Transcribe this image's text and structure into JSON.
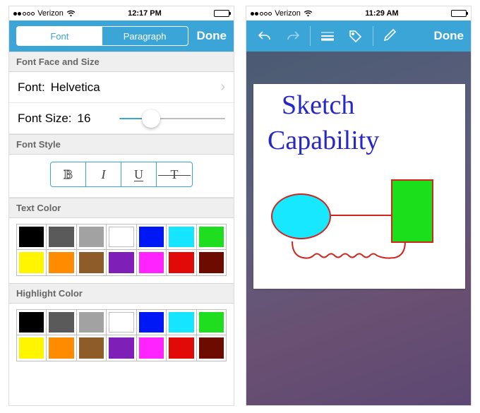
{
  "left": {
    "status": {
      "carrier": "Verizon",
      "time": "12:17 PM"
    },
    "toolbar": {
      "seg_font": "Font",
      "seg_paragraph": "Paragraph",
      "done": "Done"
    },
    "font_face_size_header": "Font Face and Size",
    "font_label": "Font:",
    "font_value": "Helvetica",
    "font_size_label": "Font Size:",
    "font_size_value": "16",
    "font_style_header": "Font Style",
    "style_bold": "B",
    "style_italic": "I",
    "style_underline": "U",
    "style_strike": "T",
    "text_color_header": "Text Color",
    "text_colors_row1": [
      "#000000",
      "#5a5a5a",
      "#a2a2a2",
      "#ffffff",
      "#0018f5",
      "#16e5ff",
      "#1fde1f"
    ],
    "text_colors_row2": [
      "#fff500",
      "#ff8b00",
      "#8e5c29",
      "#7e1fb8",
      "#ff24ff",
      "#e20909",
      "#6d0b00"
    ],
    "highlight_color_header": "Highlight Color",
    "highlight_colors_row1": [
      "#000000",
      "#5a5a5a",
      "#a2a2a2",
      "#ffffff",
      "#0018f5",
      "#16e5ff",
      "#1fde1f"
    ],
    "highlight_colors_row2": [
      "#fff500",
      "#ff8b00",
      "#8e5c29",
      "#7e1fb8",
      "#ff24ff",
      "#e20909",
      "#6d0b00"
    ]
  },
  "right": {
    "status": {
      "carrier": "Verizon",
      "time": "11:29 AM"
    },
    "toolbar": {
      "done": "Done"
    },
    "sketch_line1": "Sketch",
    "sketch_line2": "Capability"
  }
}
